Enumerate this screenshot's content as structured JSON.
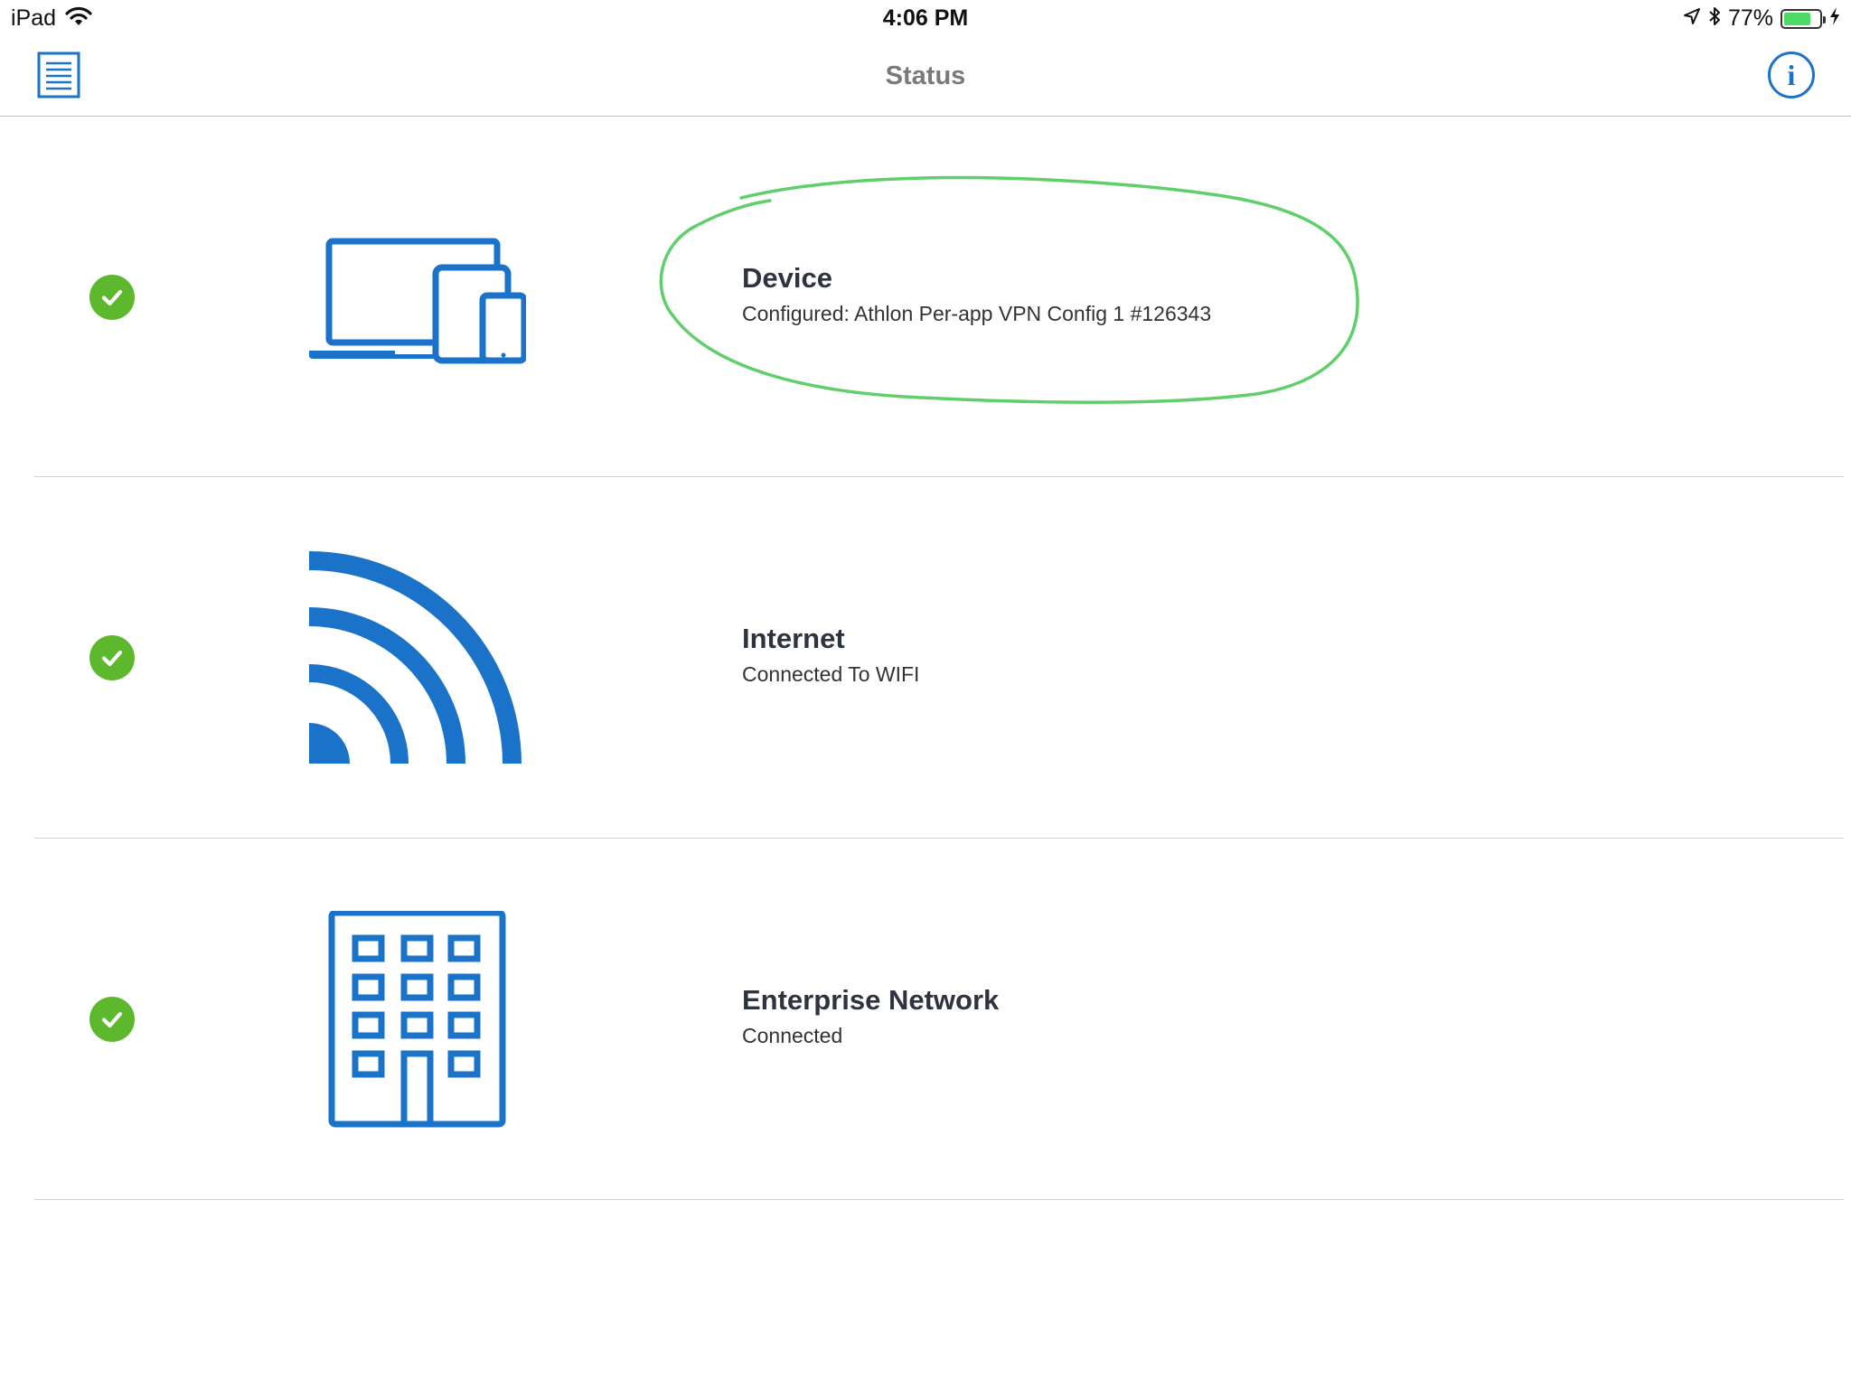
{
  "status_bar": {
    "device": "iPad",
    "time": "4:06 PM",
    "battery_percent": "77%",
    "battery_level": 0.77,
    "icons": [
      "wifi-icon",
      "location-arrow-icon",
      "bluetooth-icon",
      "battery-icon",
      "charging-bolt-icon"
    ]
  },
  "nav": {
    "title": "Status",
    "left_button_icon": "document-list-icon",
    "right_button_icon": "info-icon",
    "right_button_glyph": "i"
  },
  "rows": [
    {
      "title": "Device",
      "subtitle": "Configured: Athlon Per-app VPN Config 1 #126343",
      "status_icon": "check-circle-icon",
      "icon": "devices-icon"
    },
    {
      "title": "Internet",
      "subtitle": "Connected To WIFI",
      "status_icon": "check-circle-icon",
      "icon": "wifi-signal-icon"
    },
    {
      "title": "Enterprise Network",
      "subtitle": "Connected",
      "status_icon": "check-circle-icon",
      "icon": "office-building-icon"
    }
  ],
  "colors": {
    "accent_blue": "#1a73c8",
    "check_green": "#5db82e",
    "annotation_green": "#5fcf6b",
    "battery_green": "#4cd964"
  }
}
